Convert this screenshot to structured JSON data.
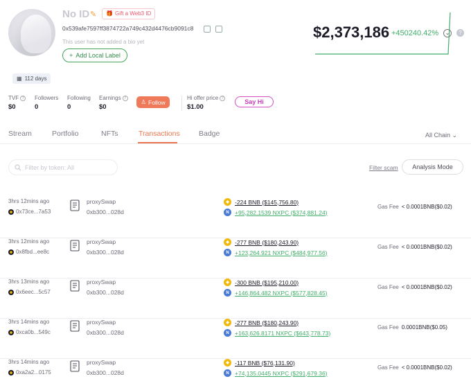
{
  "profile": {
    "name": "No ID",
    "gift_label": "Gift a Web3 ID",
    "address": "0x539afe7597ff3874722a749c432d4476cb9091c8",
    "bio": "This user has not added a bio yet",
    "add_label": "Add Local Label",
    "days": "112 days"
  },
  "balance": {
    "value": "$2,373,186",
    "change": "+450240.42%"
  },
  "stats": {
    "tvf_label": "TVF",
    "tvf_value": "$0",
    "followers_label": "Followers",
    "followers_value": "0",
    "following_label": "Following",
    "following_value": "0",
    "earnings_label": "Earnings",
    "earnings_value": "$0",
    "follow_label": "Follow",
    "hi_offer_label": "Hi offer price",
    "hi_offer_value": "$1.00",
    "say_hi_label": "Say Hi"
  },
  "tabs": [
    "Stream",
    "Portfolio",
    "NFTs",
    "Transactions",
    "Badge"
  ],
  "active_tab": "Transactions",
  "all_chain": "All Chain",
  "filter": {
    "placeholder": "Filter by token: All",
    "scam_label": "Filter scam",
    "analysis_label": "Analysis Mode"
  },
  "transactions": [
    {
      "time": "3hrs 12mins ago",
      "from": "0x73ce...7a53",
      "method": "proxySwap",
      "contract": "0xb300...028d",
      "out": "-224 BNB ($145,756.80)",
      "in": "+95,282.1539 NXPC ($374,881.24)",
      "gas_label": "Gas Fee",
      "gas": "< 0.0001BNB($0.02)"
    },
    {
      "time": "3hrs 12mins ago",
      "from": "0x8fbd...ee8c",
      "method": "proxySwap",
      "contract": "0xb300...028d",
      "out": "-277 BNB ($180,243.90)",
      "in": "+123,264.921 NXPC ($484,977.56)",
      "gas_label": "Gas Fee",
      "gas": "< 0.0001BNB($0.02)"
    },
    {
      "time": "3hrs 13mins ago",
      "from": "0x6eec...5c57",
      "method": "proxySwap",
      "contract": "0xb300...028d",
      "out": "-300 BNB ($195,210.00)",
      "in": "+146,864.482 NXPC ($577,828.45)",
      "gas_label": "Gas Fee",
      "gas": "< 0.0001BNB($0.02)"
    },
    {
      "time": "3hrs 14mins ago",
      "from": "0xca0b...549c",
      "method": "proxySwap",
      "contract": "0xb300...028d",
      "out": "-277 BNB ($180,243.90)",
      "in": "+163,626.8171 NXPC ($643,778.73)",
      "gas_label": "Gas Fee",
      "gas": "0.0001BNB($0.05)"
    },
    {
      "time": "3hrs 14mins ago",
      "from": "0xa2a2...0175",
      "method": "proxySwap",
      "contract": "0xb300...028d",
      "out": "-117 BNB ($76,131.90)",
      "in": "+74,135.0445 NXPC ($291,679.36)",
      "gas_label": "Gas Fee",
      "gas": "< 0.0001BNB($0.02)"
    }
  ],
  "colors": {
    "accent": "#e8764f",
    "positive": "#3fae68",
    "bnb": "#f0b90b",
    "nxpc": "#4a7bd4"
  }
}
